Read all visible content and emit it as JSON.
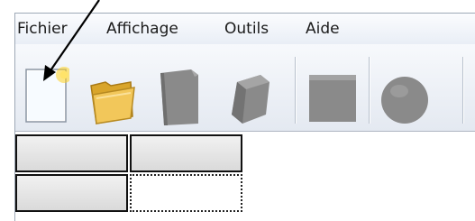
{
  "menu": {
    "items": [
      {
        "label": "Fichier"
      },
      {
        "label": "Affichage"
      },
      {
        "label": "Outils"
      },
      {
        "label": "Aide"
      }
    ]
  },
  "toolbar": {
    "buttons": [
      {
        "icon": "new-file-icon",
        "state": "enabled"
      },
      {
        "icon": "open-folder-icon",
        "state": "enabled"
      },
      {
        "icon": "notebook-icon",
        "state": "disabled"
      },
      {
        "icon": "cube-icon",
        "state": "disabled"
      },
      {
        "icon": "square-shape-icon",
        "state": "disabled"
      },
      {
        "icon": "circle-shape-icon",
        "state": "disabled"
      }
    ]
  },
  "grid": {
    "rows": 2,
    "columns": 2,
    "selected_cell": {
      "row": 2,
      "column": 2
    }
  },
  "colors": {
    "disabled_icon": "#8a8a8a",
    "folder": "#f0c24a",
    "new_file_sparkle": "#ffd21f",
    "annotation_arrow": "#000000"
  }
}
